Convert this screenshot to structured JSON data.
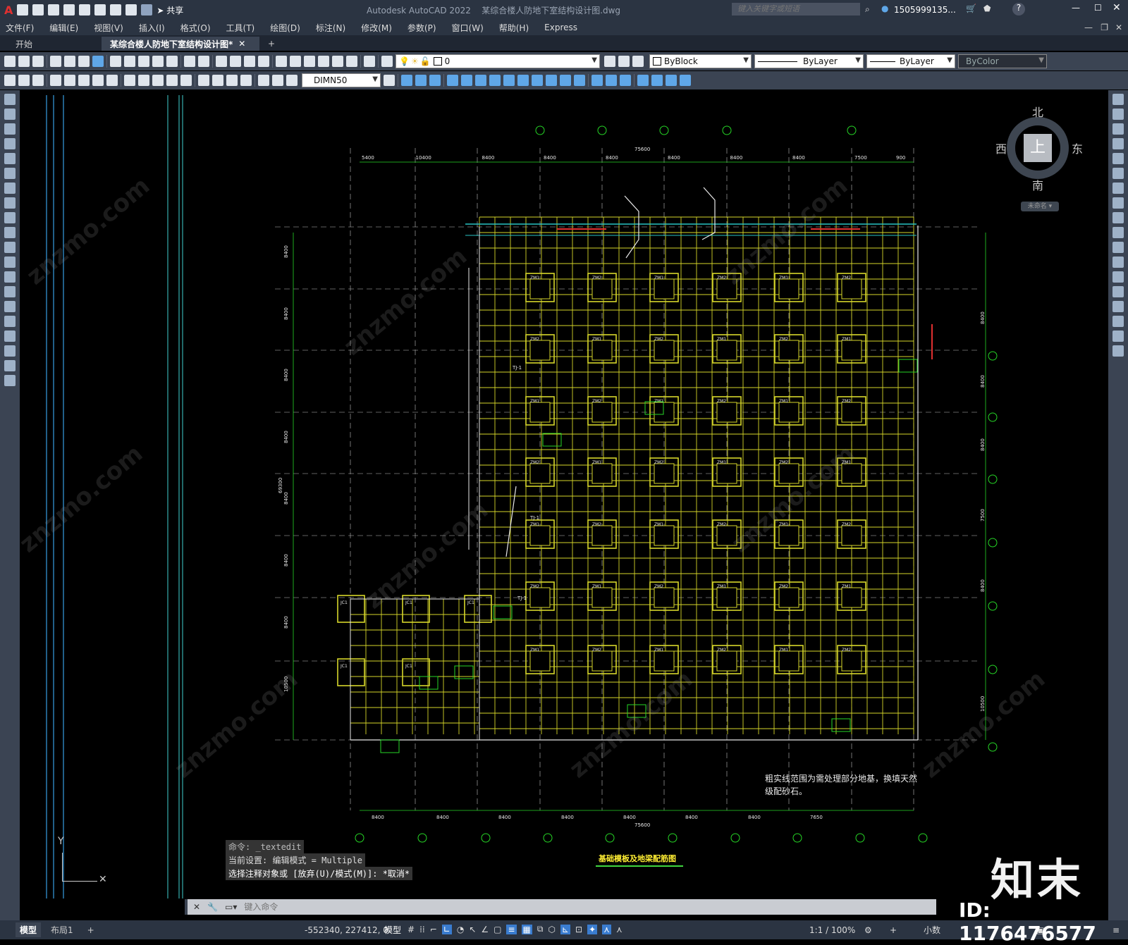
{
  "app": {
    "logo": "A",
    "title": "Autodesk AutoCAD 2022",
    "filename": "某综合楼人防地下室结构设计图.dwg",
    "share_label": "共享",
    "search_placeholder": "键入关键字或短语",
    "user": "1505999135..."
  },
  "menu": [
    "文件(F)",
    "编辑(E)",
    "视图(V)",
    "插入(I)",
    "格式(O)",
    "工具(T)",
    "绘图(D)",
    "标注(N)",
    "修改(M)",
    "参数(P)",
    "窗口(W)",
    "帮助(H)",
    "Express"
  ],
  "tabs": [
    "开始",
    "某综合楼人防地下室结构设计图*",
    "+"
  ],
  "toolbar": {
    "layer_value": "0",
    "color_value": "ByBlock",
    "linetype_value": "ByLayer",
    "lineweight_value": "ByLayer",
    "plotstyle_value": "ByColor",
    "dimstyle_value": "DIMN50"
  },
  "viewcube": {
    "north": "北",
    "south": "南",
    "east": "东",
    "west": "西",
    "top": "上",
    "ucs": "未命名"
  },
  "drawing": {
    "top_total": "75600",
    "bottom_total": "75600",
    "top_dims": [
      "5400",
      "10400",
      "8400",
      "8400",
      "8400",
      "8400",
      "8400",
      "8400",
      "7500",
      "900"
    ],
    "bottom_dims": [
      "8400",
      "8400",
      "8400",
      "8400",
      "8400",
      "8400",
      "8400",
      "7650"
    ],
    "left_dims": [
      "8400",
      "8400",
      "8400",
      "8400",
      "8400",
      "8400",
      "8400",
      "10500"
    ],
    "left_total": "69300",
    "right_dims": [
      "8400",
      "8400",
      "8400",
      "7500",
      "8400",
      "10500"
    ],
    "note_line1": "粗实线范围为需处理部分地基，换填天然",
    "note_line2": "级配砂石。",
    "drawing_title": "基础模板及地梁配筋图",
    "pier_labels": [
      "ZM1",
      "ZM2",
      "JC1",
      "JC2",
      "ZJ3"
    ],
    "beam_label": "TJ-1"
  },
  "command": {
    "history": [
      "命令: _textedit",
      "当前设置: 编辑模式 = Multiple",
      "选择注释对象或 [放弃(U)/模式(M)]: *取消*"
    ],
    "placeholder": "键入命令"
  },
  "status": {
    "tabs": [
      "模型",
      "布局1",
      "+"
    ],
    "coords": "-552340, 227412, 0",
    "space": "模型",
    "scale": "1:1 / 100%",
    "units": "小数"
  },
  "overlay": {
    "brand": "知末",
    "id_text": "ID: 1176476577",
    "watermark": "znzmo.com"
  },
  "colors": {
    "grid": "#d6d62a",
    "axis": "#6fb1d6",
    "green": "#26d626",
    "red": "#e03030",
    "cyan": "#29c3c3",
    "white": "#e8e8e8"
  }
}
